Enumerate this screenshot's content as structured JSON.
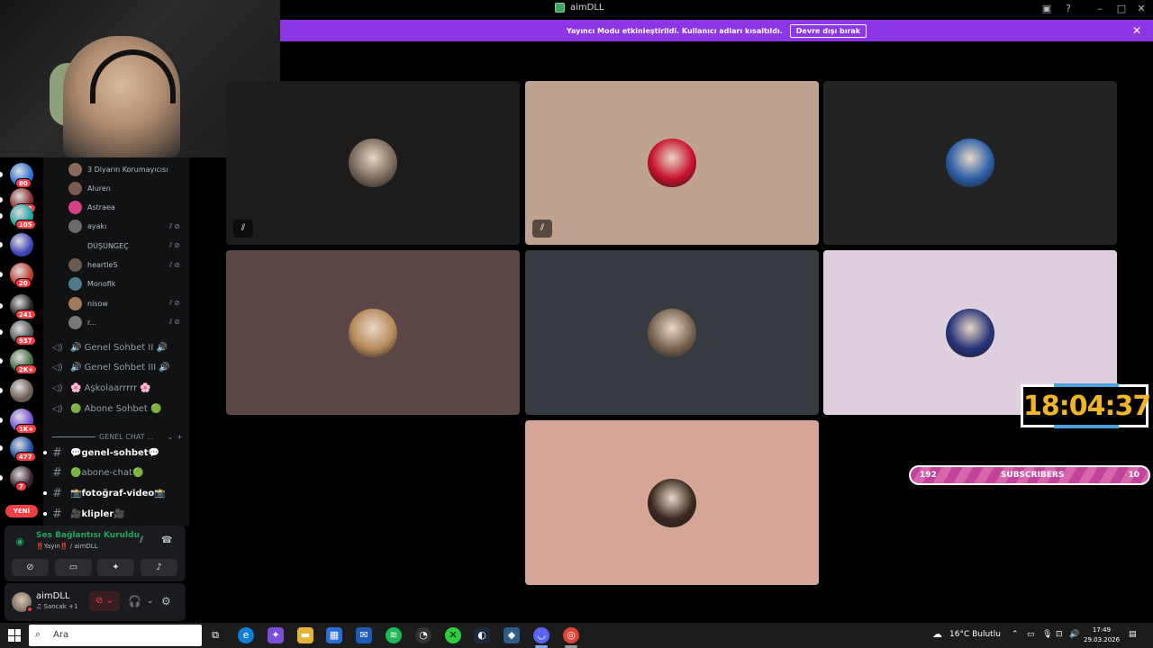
{
  "window": {
    "title": "aimDLL",
    "controls": [
      "window-list-icon",
      "help-icon",
      "minimize-icon",
      "maximize-icon",
      "close-icon"
    ]
  },
  "banner": {
    "text": "Yayıncı Modu etkinleştirildi. Kullanıcı adları kısaltıldı.",
    "button": "Devre dışı bırak"
  },
  "servers": [
    {
      "badge": "80"
    },
    {
      "badge": "292"
    },
    {
      "badge": "105"
    },
    {
      "badge": ""
    },
    {
      "badge": "20"
    },
    {
      "badge": "241"
    },
    {
      "badge": "937"
    },
    {
      "badge": "2K+"
    },
    {
      "badge": ""
    },
    {
      "badge": "1K+"
    },
    {
      "badge": "477"
    },
    {
      "badge": "7"
    }
  ],
  "new_label": "YENİ",
  "voice_users": [
    {
      "name": "3 Diyarın Korumayıcısı",
      "muted": false
    },
    {
      "name": "Aluren",
      "muted": false
    },
    {
      "name": "Astraea",
      "muted": false
    },
    {
      "name": "ayakı",
      "muted": true
    },
    {
      "name": "DÜŞÜNGEÇ",
      "muted": true
    },
    {
      "name": "heartleS",
      "muted": true
    },
    {
      "name": "Monofik",
      "muted": false
    },
    {
      "name": "nisow",
      "muted": true
    },
    {
      "name": "r...",
      "muted": true
    }
  ],
  "voice_channels": [
    {
      "name": "🔊 Genel Sohbet II 🔊"
    },
    {
      "name": "🔊 Genel Sohbet III 🔊"
    },
    {
      "name": "🌸 Aşkolaarrrrr 🌸"
    },
    {
      "name": "🟢 Abone Sohbet 🟢"
    }
  ],
  "category": {
    "name": "GENEL CHAT ..."
  },
  "text_channels": [
    {
      "name": "💬genel-sohbet💬",
      "unread": true
    },
    {
      "name": "🟢abone-chat🟢",
      "unread": false
    },
    {
      "name": "📸fotoğraf-video📸",
      "unread": true
    },
    {
      "name": "🎥klipler🎥",
      "unread": true
    }
  ],
  "voice_status": {
    "status": "Ses Bağlantısı Kuruldu",
    "channel": "‼️Yayın‼️ / aimDLL"
  },
  "user": {
    "name": "aimDLL",
    "status": "♫ Sancak +1"
  },
  "tiles": [
    {
      "bg": "#1e1b1b",
      "avatar": "#7a6a5c",
      "muted": true
    },
    {
      "bg": "#bea391",
      "avatar": "#c8102e",
      "muted": true
    },
    {
      "bg": "#222424",
      "avatar": "#2a5fa8",
      "muted": false
    },
    {
      "bg": "#5b4646",
      "avatar": "#b88a5a",
      "muted": false
    },
    {
      "bg": "#363b41",
      "avatar": "#7a6450",
      "muted": false
    },
    {
      "bg": "#e0cfdf",
      "avatar": "#27347a",
      "muted": false
    },
    {
      "bg": "#d5a598",
      "avatar": "#3a2a22",
      "muted": false
    }
  ],
  "overlay": {
    "clock": "18:04:37",
    "subs_left": "192",
    "subs_label": "SUBSCRIBERS",
    "subs_right": "10"
  },
  "taskbar": {
    "search_placeholder": "Ara",
    "weather": "16°C  Bulutlu",
    "time": "17:49",
    "date": "29.03.2026"
  }
}
